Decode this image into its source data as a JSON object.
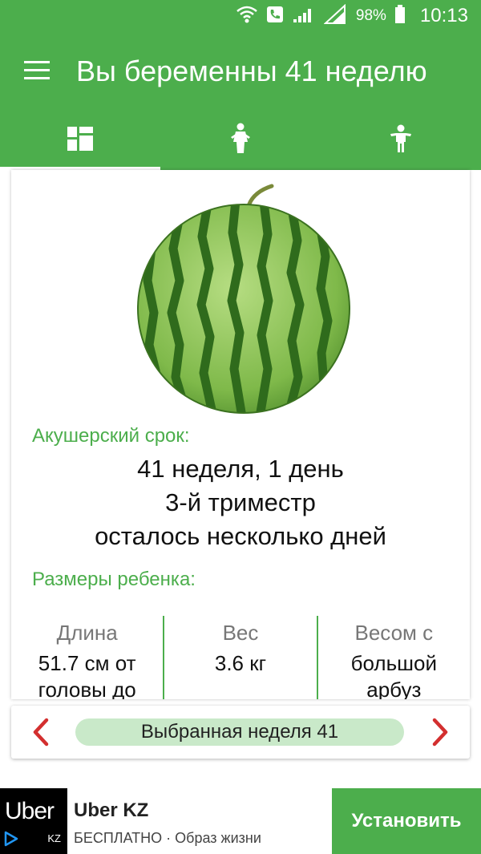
{
  "status_bar": {
    "battery": "98%",
    "time": "10:13"
  },
  "app_bar": {
    "title": "Вы беременны 41 неделю",
    "tabs": [
      {
        "icon": "dashboard-icon",
        "active": true
      },
      {
        "icon": "pregnant-woman-icon",
        "active": false
      },
      {
        "icon": "child-icon",
        "active": false
      }
    ]
  },
  "content": {
    "fruit_image": "watermelon",
    "obstetric_label": "Акушерский срок:",
    "summary_lines": [
      "41 неделя, 1 день",
      "3-й триместр",
      "осталось несколько дней"
    ],
    "sizes_label": "Размеры ребенка:",
    "sizes": [
      {
        "header": "Длина",
        "value_lines": [
          "51.7 см от",
          "головы до"
        ]
      },
      {
        "header": "Вес",
        "value_lines": [
          "3.6 кг"
        ]
      },
      {
        "header": "Весом с",
        "value_lines": [
          "большой",
          "арбуз"
        ]
      }
    ]
  },
  "week_selector": {
    "label": "Выбранная неделя 41"
  },
  "ad": {
    "logo_text": "Uber",
    "logo_sub": "KZ",
    "title": "Uber KZ",
    "subtitle": "БЕСПЛАТНО · Образ жизни",
    "button": "Установить"
  },
  "colors": {
    "primary": "#4cae4c",
    "accent_arrow": "#d32f2f",
    "pill": "#c9e9c9"
  }
}
